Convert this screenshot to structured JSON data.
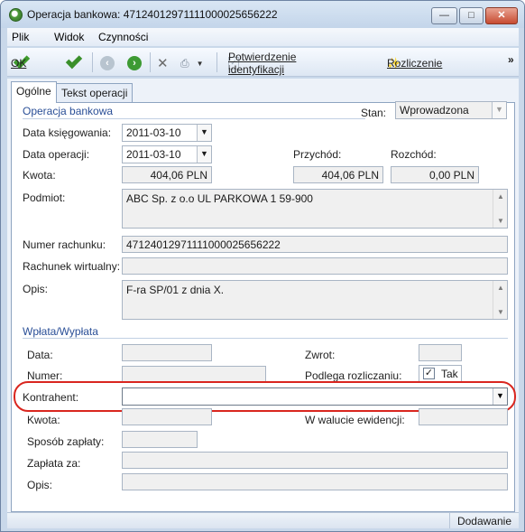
{
  "window": {
    "title": "Operacja bankowa: 471240129711110000256562​22"
  },
  "menu": {
    "items": [
      "Plik",
      "Widok",
      "Czynności"
    ]
  },
  "toolbar": {
    "ok_label": "OK",
    "confirm_label": "Potwierdzenie identyfikacji",
    "settle_label": "Rozliczenie",
    "overflow": "»"
  },
  "tabs": [
    "Ogólne",
    "Tekst operacji"
  ],
  "operacja": {
    "section_title": "Operacja bankowa",
    "stan_label": "Stan:",
    "stan_value": "Wprowadzona",
    "data_ksiegowania_label": "Data księgowania:",
    "data_ksiegowania": "2011-03-10",
    "data_operacji_label": "Data operacji:",
    "data_operacji": "2011-03-10",
    "przychod_label": "Przychód:",
    "rozchod_label": "Rozchód:",
    "kwota_label": "Kwota:",
    "kwota": "404,06 PLN",
    "przychod": "404,06 PLN",
    "rozchod": "0,00 PLN",
    "podmiot_label": "Podmiot:",
    "podmiot": "ABC Sp. z o.o UL PARKOWA 1 59-900",
    "numer_rachunku_label": "Numer rachunku:",
    "numer_rachunku": "47124012971111000025656222",
    "rachunek_wirtualny_label": "Rachunek wirtualny:",
    "rachunek_wirtualny": "",
    "opis_label": "Opis:",
    "opis": "F-ra SP/01 z dnia X."
  },
  "wplata": {
    "section_title": "Wpłata/Wypłata",
    "data_label": "Data:",
    "zwrot_label": "Zwrot:",
    "numer_label": "Numer:",
    "podlega_label": "Podlega rozliczaniu:",
    "tak_label": "Tak",
    "podlega_checked": true,
    "kontrahent_label": "Kontrahent:",
    "kontrahent_value": "",
    "kwota_label": "Kwota:",
    "w_walucie_label": "W walucie ewidencji:",
    "sposob_label": "Sposób zapłaty:",
    "zaplata_za_label": "Zapłata za:",
    "opis_label": "Opis:"
  },
  "status": {
    "mode": "Dodawanie"
  }
}
